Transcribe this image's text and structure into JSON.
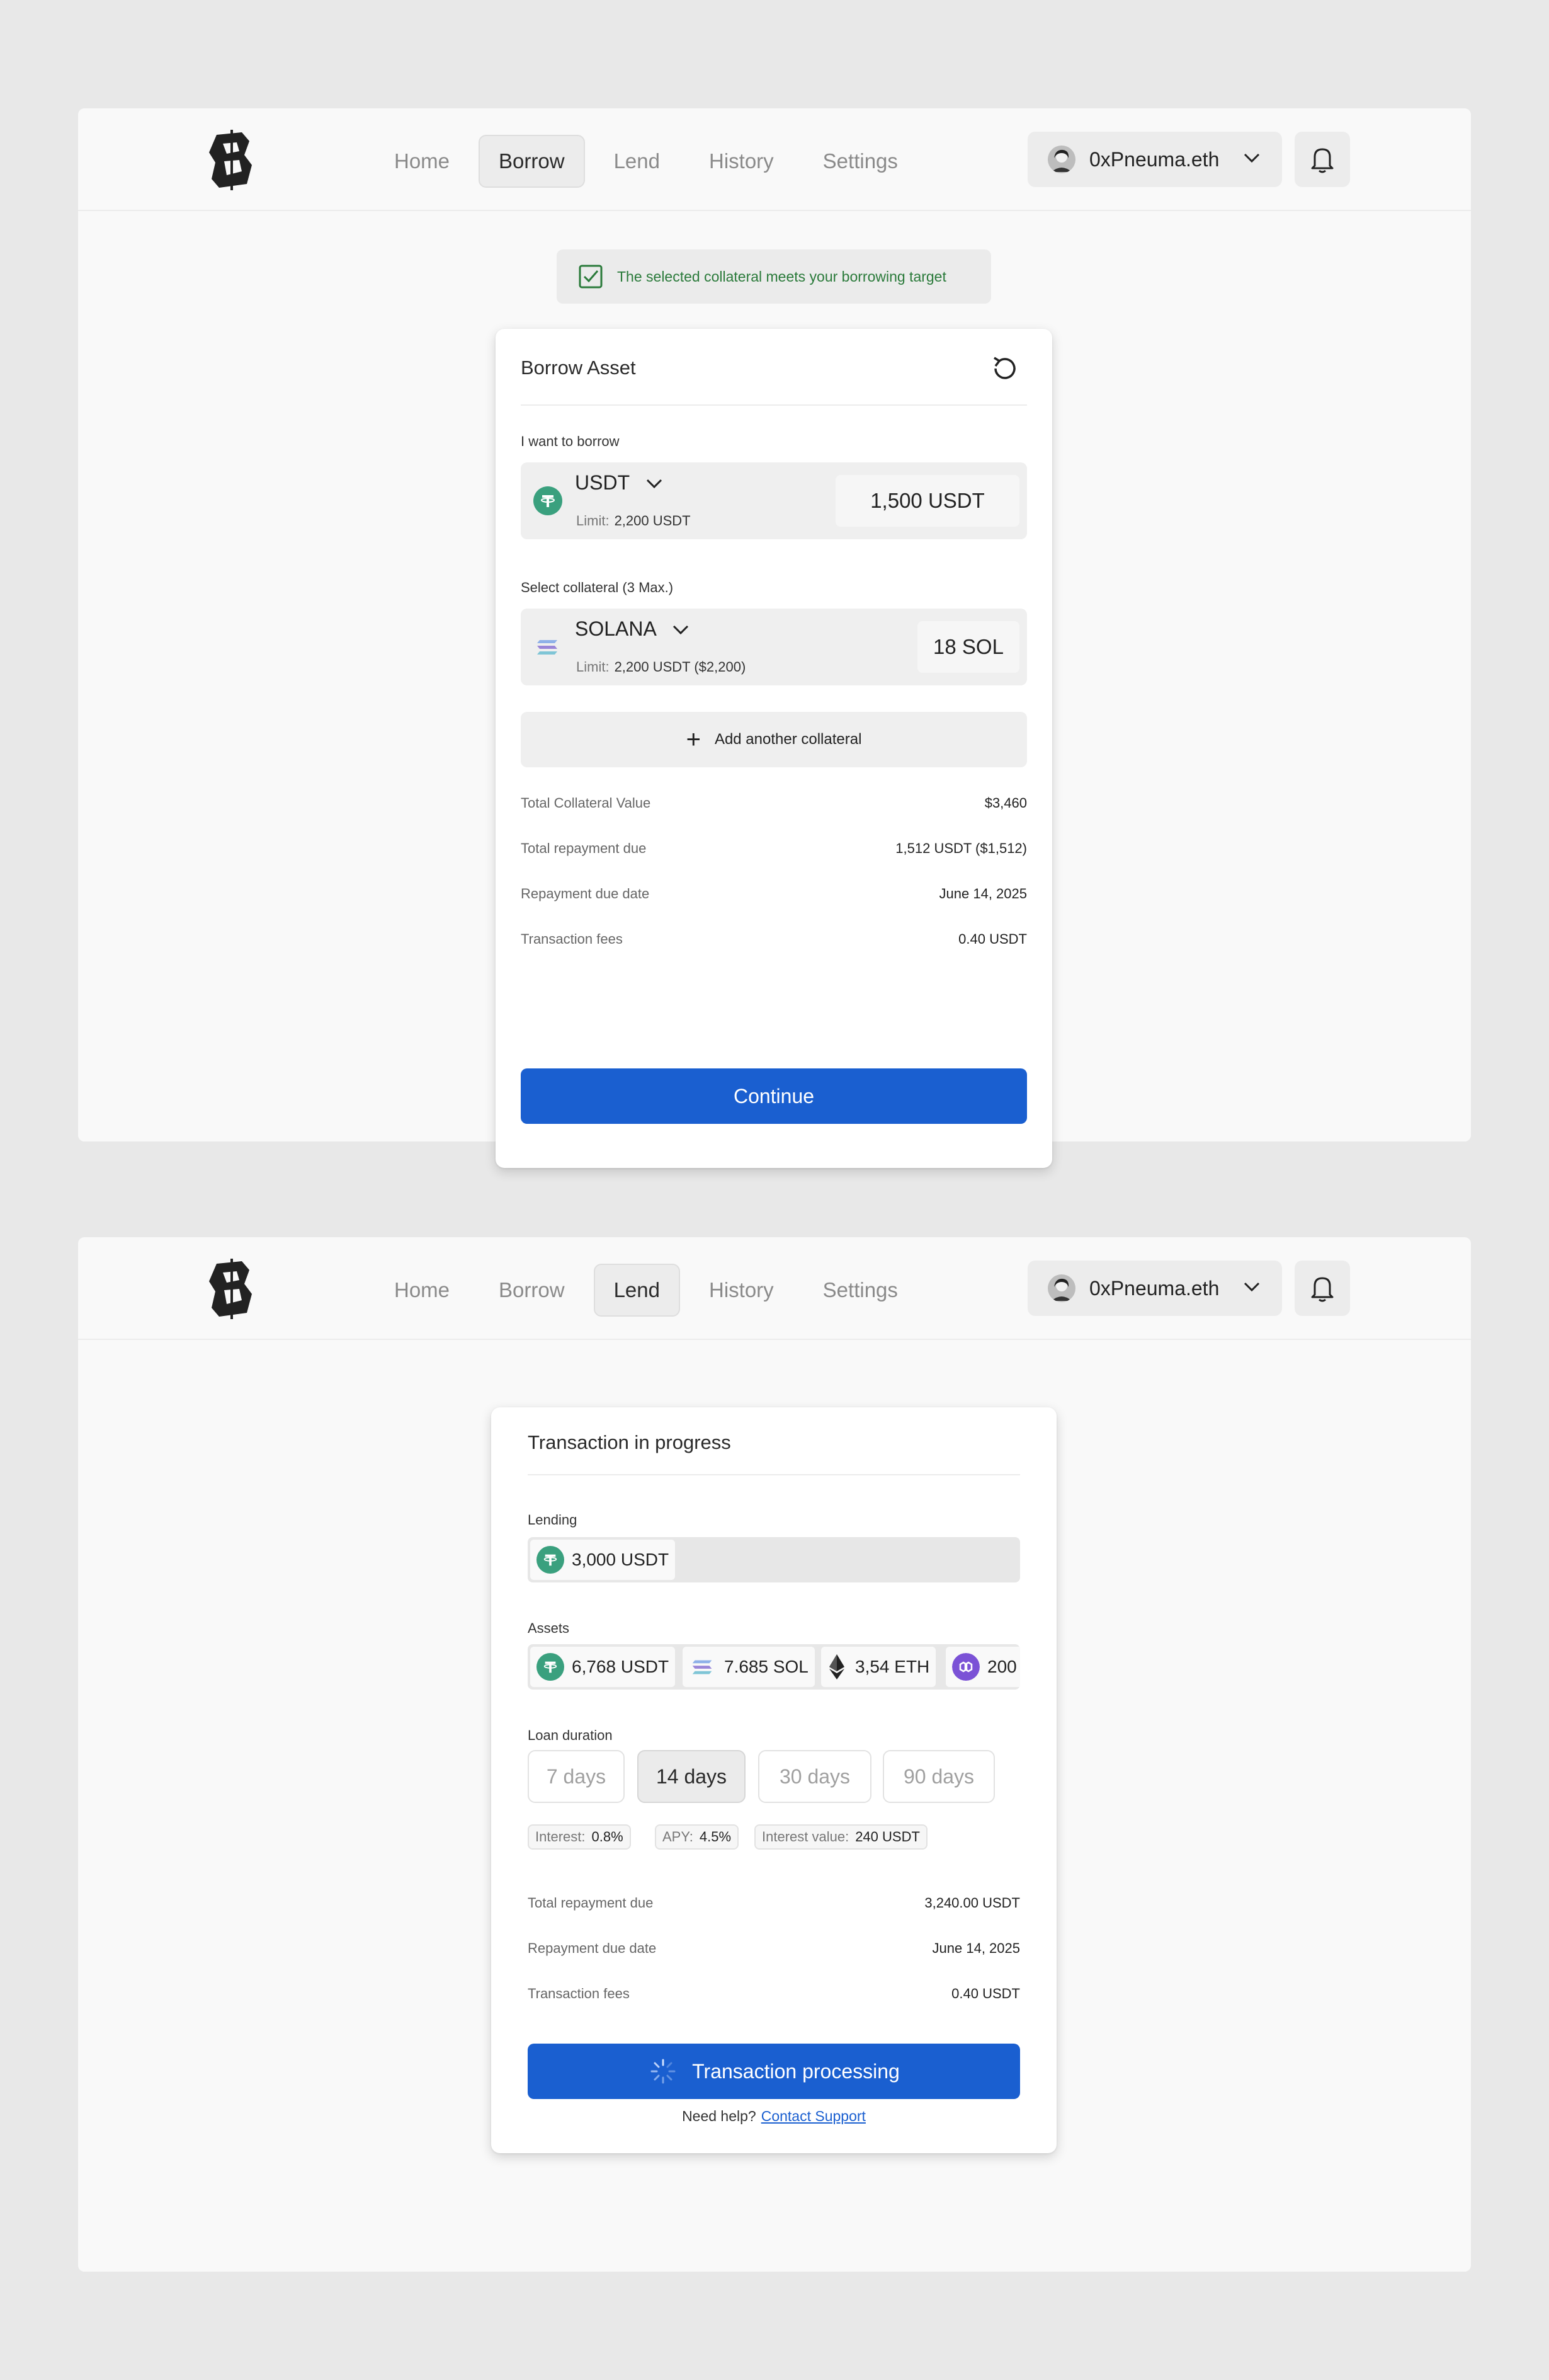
{
  "colors": {
    "accent": "#1a5fd0",
    "success": "#2a7a3a",
    "usdt": "#3aa07e",
    "polygon": "#7b52d6"
  },
  "screen1": {
    "nav": {
      "home": "Home",
      "borrow": "Borrow",
      "lend": "Lend",
      "history": "History",
      "settings": "Settings",
      "active": "Borrow"
    },
    "user": {
      "name": "0xPneuma.eth"
    },
    "toast": {
      "text": "The selected collateral meets your borrowing target",
      "icon": "checkbox-checked-icon"
    },
    "card": {
      "title": "Borrow Asset",
      "reset_icon": "refresh-icon",
      "borrow_label": "I want to borrow",
      "borrow_asset": {
        "name": "USDT",
        "limit_label": "Limit:",
        "limit_value": "2,200 USDT",
        "amount": "1,500 USDT"
      },
      "collateral_label": "Select collateral (3 Max.)",
      "collateral_asset": {
        "name": "SOLANA",
        "limit_label": "Limit:",
        "limit_value": "2,200 USDT ($2,200)",
        "amount": "18 SOL"
      },
      "add_collateral": "Add another collateral",
      "summary": [
        {
          "label": "Total Collateral Value",
          "value": "$3,460"
        },
        {
          "label": "Total repayment due",
          "value": "1,512 USDT ($1,512)"
        },
        {
          "label": "Repayment due date",
          "value": "June 14, 2025"
        },
        {
          "label": "Transaction fees",
          "value": "0.40 USDT"
        }
      ],
      "continue": "Continue"
    }
  },
  "screen2": {
    "nav": {
      "home": "Home",
      "borrow": "Borrow",
      "lend": "Lend",
      "history": "History",
      "settings": "Settings",
      "active": "Lend"
    },
    "user": {
      "name": "0xPneuma.eth"
    },
    "card": {
      "title": "Transaction in progress",
      "lending_label": "Lending",
      "lending_value": "3,000 USDT",
      "assets_label": "Assets",
      "assets": [
        {
          "icon": "usdt-icon",
          "value": "6,768 USDT"
        },
        {
          "icon": "solana-icon",
          "value": "7.685 SOL"
        },
        {
          "icon": "ethereum-icon",
          "value": "3,54 ETH"
        },
        {
          "icon": "polygon-icon",
          "value": "200"
        }
      ],
      "duration_label": "Loan duration",
      "durations": [
        "7 days",
        "14 days",
        "30 days",
        "90 days"
      ],
      "selected_duration": "14 days",
      "badges": [
        {
          "label": "Interest:",
          "value": "0.8%"
        },
        {
          "label": "APY:",
          "value": "4.5%"
        },
        {
          "label": "Interest value:",
          "value": "240 USDT"
        }
      ],
      "summary": [
        {
          "label": "Total repayment due",
          "value": "3,240.00 USDT"
        },
        {
          "label": "Repayment due date",
          "value": "June 14, 2025"
        },
        {
          "label": "Transaction fees",
          "value": "0.40 USDT"
        }
      ],
      "processing": "Transaction processing",
      "help_text": "Need help?",
      "help_link": "Contact Support"
    }
  }
}
